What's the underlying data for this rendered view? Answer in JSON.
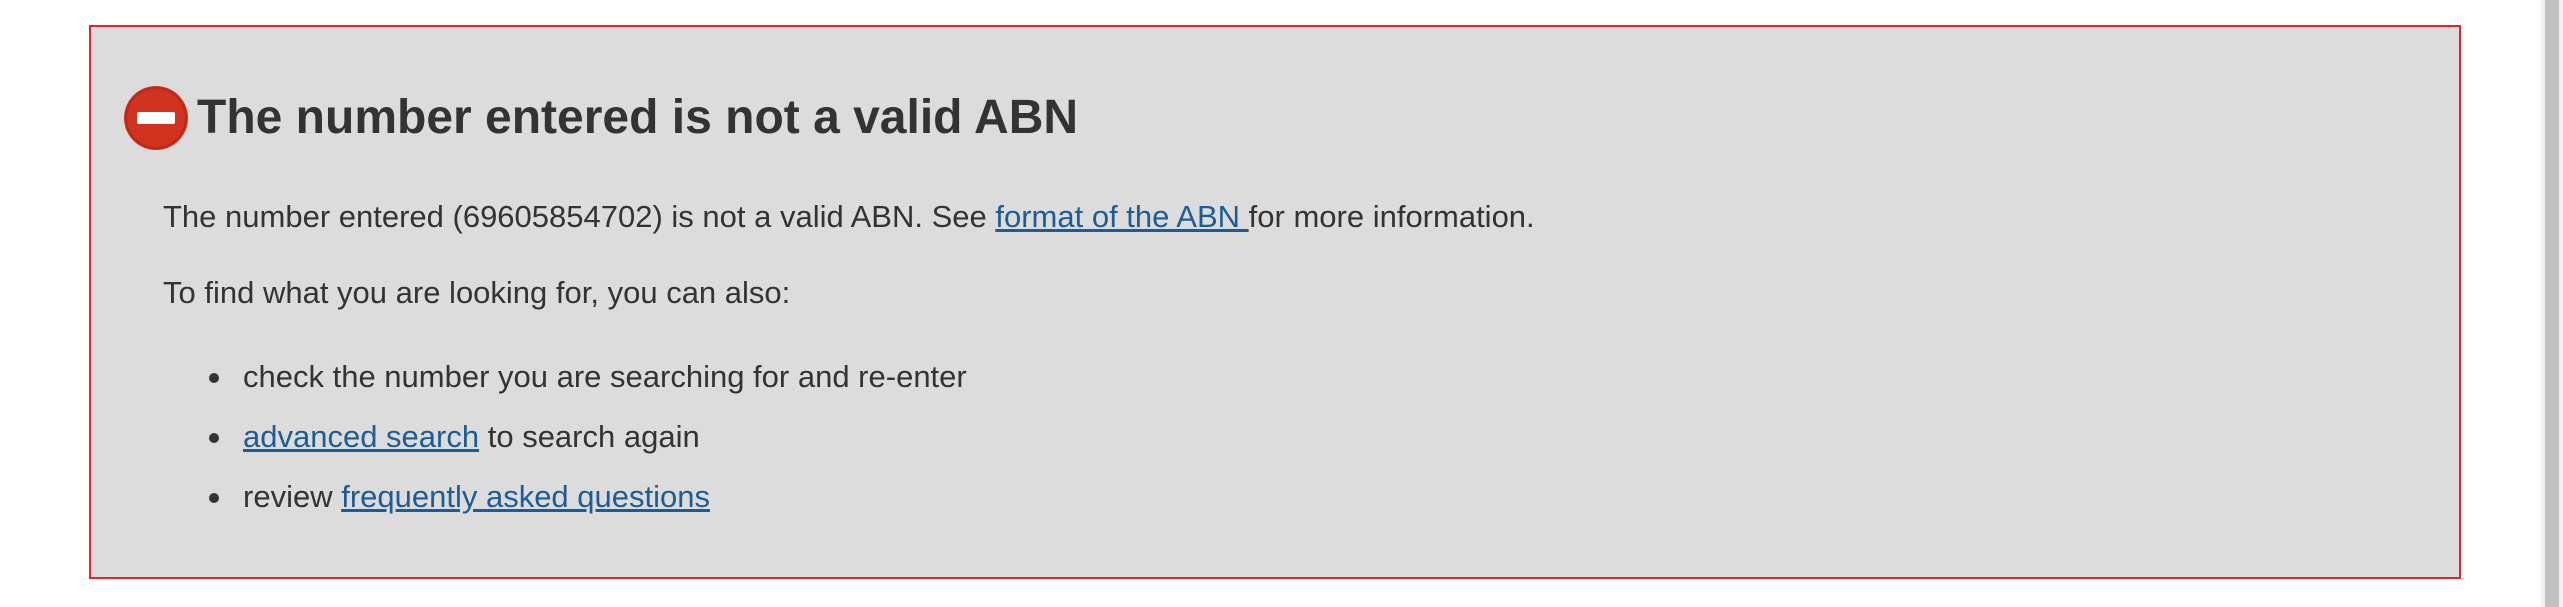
{
  "error": {
    "heading": "The number entered is not a valid ABN",
    "icon": "no-entry-icon",
    "icon_color": "#d0331f",
    "border_color": "#e0262d",
    "background_color": "#dcdcdc",
    "message_prefix": "The number entered (69605854702) is not a valid ABN. See ",
    "format_link": "format of the ABN ",
    "message_suffix": "for more information.",
    "find_intro": "To find what you are looking for, you can also:",
    "suggestions": {
      "check_text": "check the number you are searching for and re-enter",
      "advanced_link": "advanced search",
      "advanced_suffix": " to search again",
      "review_prefix": "review ",
      "faq_link": "frequently asked questions"
    }
  },
  "colors": {
    "link": "#1d5c94",
    "text": "#333333"
  }
}
